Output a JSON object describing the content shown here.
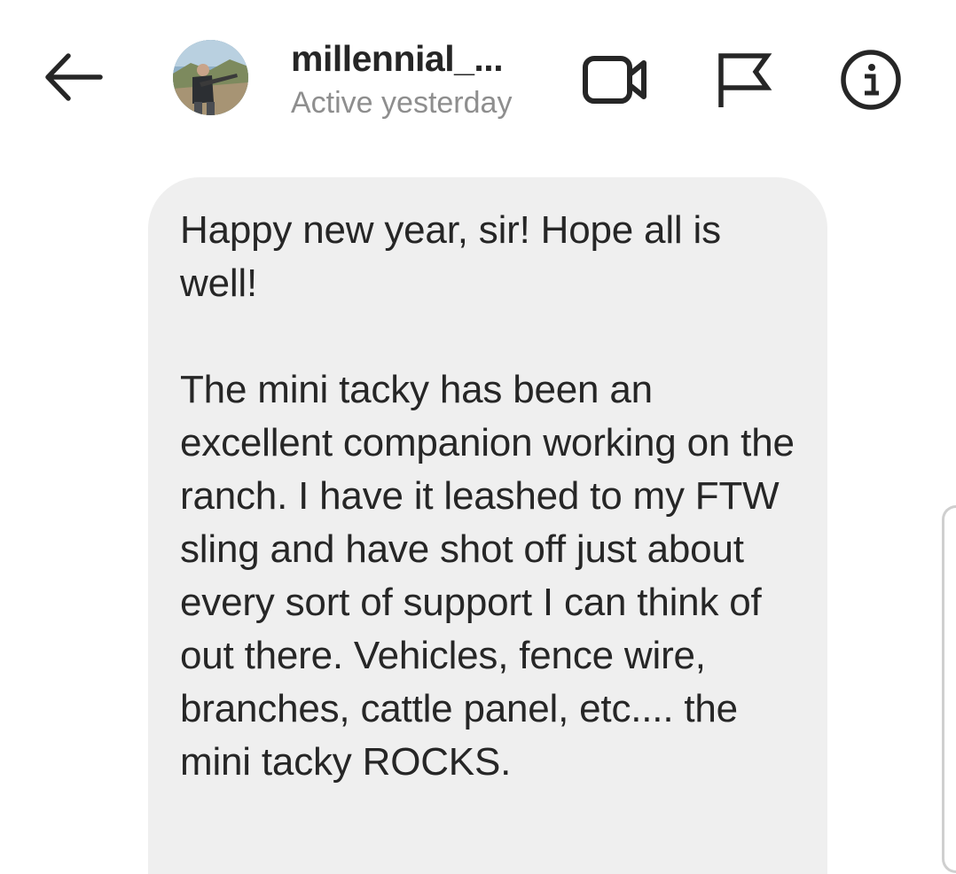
{
  "header": {
    "username": "millennial_...",
    "status": "Active yesterday"
  },
  "icons": {
    "back": "back-arrow-icon",
    "video": "video-call-icon",
    "flag": "flag-report-icon",
    "info": "info-icon"
  },
  "message": {
    "text": "Happy new year, sir! Hope all is well!\n\nThe mini tacky has been an excellent companion working on the ranch. I have it leashed to my FTW sling and have shot off just about every sort of support I can think of out there. Vehicles, fence wire, branches, cattle panel, etc.... the mini tacky ROCKS."
  },
  "colors": {
    "text": "#262626",
    "secondary_text": "#8e8e8e",
    "bubble": "#efefef"
  }
}
